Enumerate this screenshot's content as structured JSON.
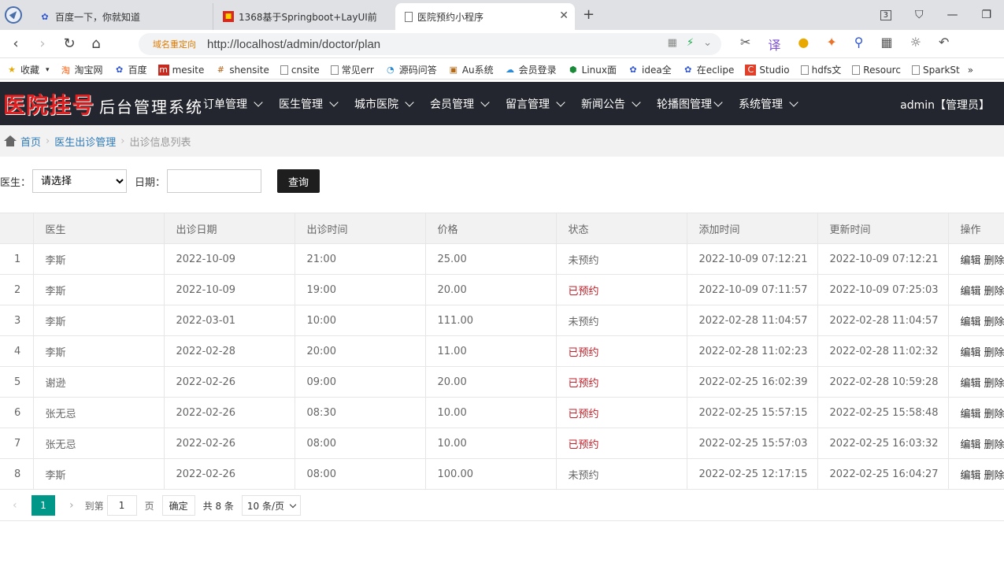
{
  "browser": {
    "tabs": [
      {
        "title": "百度一下，你就知道",
        "icon": "baidu-paw-icon"
      },
      {
        "title": "1368基于Springboot+LayUI前",
        "icon": "red-square-icon"
      },
      {
        "title": "医院预约小程序",
        "icon": "page-icon",
        "active": true
      }
    ],
    "tab_count_badge": "3",
    "redirect_label": "域名重定向",
    "url": "http://localhost/admin/doctor/plan",
    "bookmarks": [
      {
        "label": "收藏",
        "icon": "star-icon"
      },
      {
        "label": "淘宝网",
        "icon": "taobao-icon"
      },
      {
        "label": "百度",
        "icon": "baidu-paw-icon"
      },
      {
        "label": "mesite",
        "icon": "mesite-icon"
      },
      {
        "label": "shensite",
        "icon": "shensite-icon"
      },
      {
        "label": "cnsite",
        "icon": "page-icon"
      },
      {
        "label": "常见err",
        "icon": "page-icon"
      },
      {
        "label": "源码问答",
        "icon": "qa-icon"
      },
      {
        "label": "Au系统",
        "icon": "au-icon"
      },
      {
        "label": "会员登录",
        "icon": "cloud-icon"
      },
      {
        "label": "Linux面",
        "icon": "linux-icon"
      },
      {
        "label": "idea全",
        "icon": "baidu-paw-icon"
      },
      {
        "label": "在eclipe",
        "icon": "baidu-paw-icon"
      },
      {
        "label": "Studio",
        "icon": "studio-icon"
      },
      {
        "label": "hdfs文",
        "icon": "page-icon"
      },
      {
        "label": "Resourc",
        "icon": "page-icon"
      },
      {
        "label": "SparkSt",
        "icon": "page-icon"
      }
    ]
  },
  "app": {
    "logo_red": "医院挂号",
    "logo_white": "后台管理系统",
    "menu": [
      "订单管理",
      "医生管理",
      "城市医院",
      "会员管理",
      "留言管理",
      "新闻公告",
      "轮播图管理",
      "系统管理"
    ],
    "admin_label": "admin【管理员】"
  },
  "breadcrumb": {
    "home": "首页",
    "parent": "医生出诊管理",
    "current": "出诊信息列表"
  },
  "filter": {
    "doctor_label": "医生：",
    "doctor_selected": "请选择",
    "date_label": "日期：",
    "date_value": "",
    "query_label": "查询"
  },
  "table": {
    "headers": [
      "",
      "医生",
      "出诊日期",
      "出诊时间",
      "价格",
      "状态",
      "添加时间",
      "更新时间",
      "操作"
    ],
    "rows": [
      {
        "idx": "1",
        "doctor": "李斯",
        "date": "2022-10-09",
        "time": "21:00",
        "price": "25.00",
        "status": "未预约",
        "booked": false,
        "added": "2022-10-09 07:12:21",
        "updated": "2022-10-09 07:12:21"
      },
      {
        "idx": "2",
        "doctor": "李斯",
        "date": "2022-10-09",
        "time": "19:00",
        "price": "20.00",
        "status": "已预约",
        "booked": true,
        "added": "2022-10-09 07:11:57",
        "updated": "2022-10-09 07:25:03"
      },
      {
        "idx": "3",
        "doctor": "李斯",
        "date": "2022-03-01",
        "time": "10:00",
        "price": "111.00",
        "status": "未预约",
        "booked": false,
        "added": "2022-02-28 11:04:57",
        "updated": "2022-02-28 11:04:57"
      },
      {
        "idx": "4",
        "doctor": "李斯",
        "date": "2022-02-28",
        "time": "20:00",
        "price": "11.00",
        "status": "已预约",
        "booked": true,
        "added": "2022-02-28 11:02:23",
        "updated": "2022-02-28 11:02:32"
      },
      {
        "idx": "5",
        "doctor": "谢逊",
        "date": "2022-02-26",
        "time": "09:00",
        "price": "20.00",
        "status": "已预约",
        "booked": true,
        "added": "2022-02-25 16:02:39",
        "updated": "2022-02-28 10:59:28"
      },
      {
        "idx": "6",
        "doctor": "张无忌",
        "date": "2022-02-26",
        "time": "08:30",
        "price": "10.00",
        "status": "已预约",
        "booked": true,
        "added": "2022-02-25 15:57:15",
        "updated": "2022-02-25 15:58:48"
      },
      {
        "idx": "7",
        "doctor": "张无忌",
        "date": "2022-02-26",
        "time": "08:00",
        "price": "10.00",
        "status": "已预约",
        "booked": true,
        "added": "2022-02-25 15:57:03",
        "updated": "2022-02-25 16:03:32"
      },
      {
        "idx": "8",
        "doctor": "李斯",
        "date": "2022-02-26",
        "time": "08:00",
        "price": "100.00",
        "status": "未预约",
        "booked": false,
        "added": "2022-02-25 12:17:15",
        "updated": "2022-02-25 16:04:27"
      }
    ],
    "edit_label": "编辑",
    "delete_label": "删除"
  },
  "pager": {
    "current": "1",
    "goto_label": "到第",
    "goto_value": "1",
    "page_unit": "页",
    "confirm_label": "确定",
    "total_label": "共 8 条",
    "page_size": "10 条/页"
  },
  "colors": {
    "header_bg": "#23262e",
    "accent_teal": "#009688",
    "booked_red": "#c0202a",
    "link_blue": "#2f7ab8"
  }
}
